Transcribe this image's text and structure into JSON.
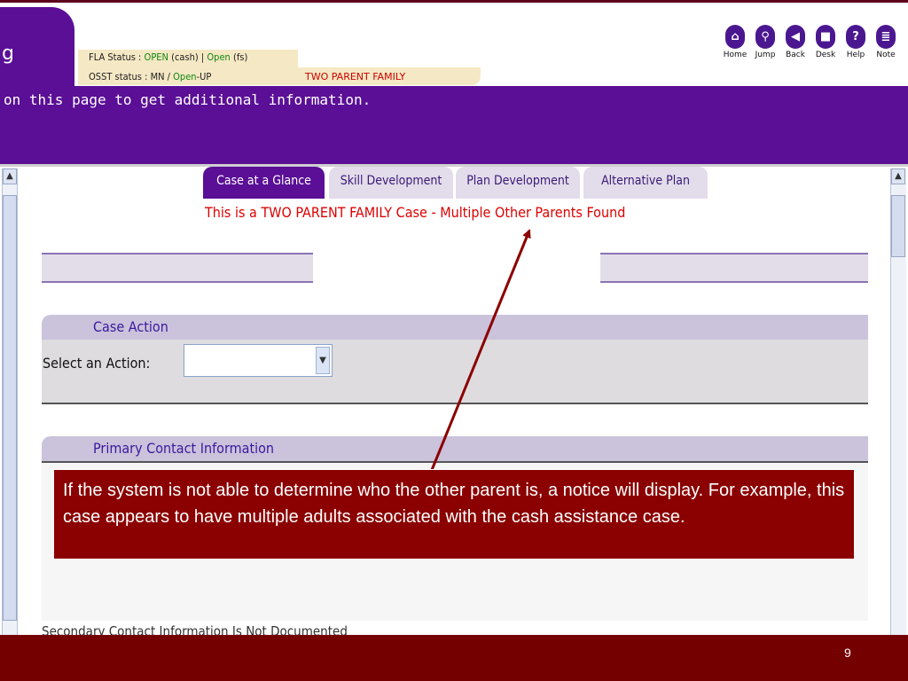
{
  "header": {
    "title_fragment": "g",
    "fla_status_prefix": "FLA Status : ",
    "fla_cash_status": "OPEN",
    "fla_cash_label": " (cash) | ",
    "fla_fs_status": "Open",
    "fla_fs_label": " (fs)",
    "osst_prefix": "OSST status : MN / ",
    "osst_status": "Open",
    "osst_suffix": "-UP",
    "family_type": "TWO PARENT FAMILY"
  },
  "nav": [
    {
      "label": "Home",
      "glyph": "⌂"
    },
    {
      "label": "Jump",
      "glyph": "⚲"
    },
    {
      "label": "Back",
      "glyph": "◀"
    },
    {
      "label": "Desk",
      "glyph": "■"
    },
    {
      "label": "Help",
      "glyph": "?"
    },
    {
      "label": "Note",
      "glyph": "≣"
    }
  ],
  "banner_text": "on this page to get additional information.",
  "tabs": [
    {
      "label": "Case at a Glance",
      "active": true
    },
    {
      "label": "Skill Development",
      "active": false
    },
    {
      "label": "Plan Development",
      "active": false
    },
    {
      "label": "Alternative Plan",
      "active": false
    }
  ],
  "notice": "This is a TWO PARENT FAMILY Case - Multiple Other Parents Found",
  "case_action": {
    "header": "Case Action",
    "select_label": "Select an Action:",
    "select_value": ""
  },
  "primary_contact": {
    "header": "Primary Contact Information"
  },
  "secondary_contact_text": "Secondary Contact Information Is Not Documented",
  "callout_text": "If the system is not able to determine who the other parent is, a notice will display.  For example, this case appears to have multiple adults associated with the cash assistance case.",
  "page_number": "9",
  "colors": {
    "purple": "#5a0f96",
    "dark_red": "#8b0000",
    "notice_red": "#dd0000",
    "status_green": "#118811"
  }
}
